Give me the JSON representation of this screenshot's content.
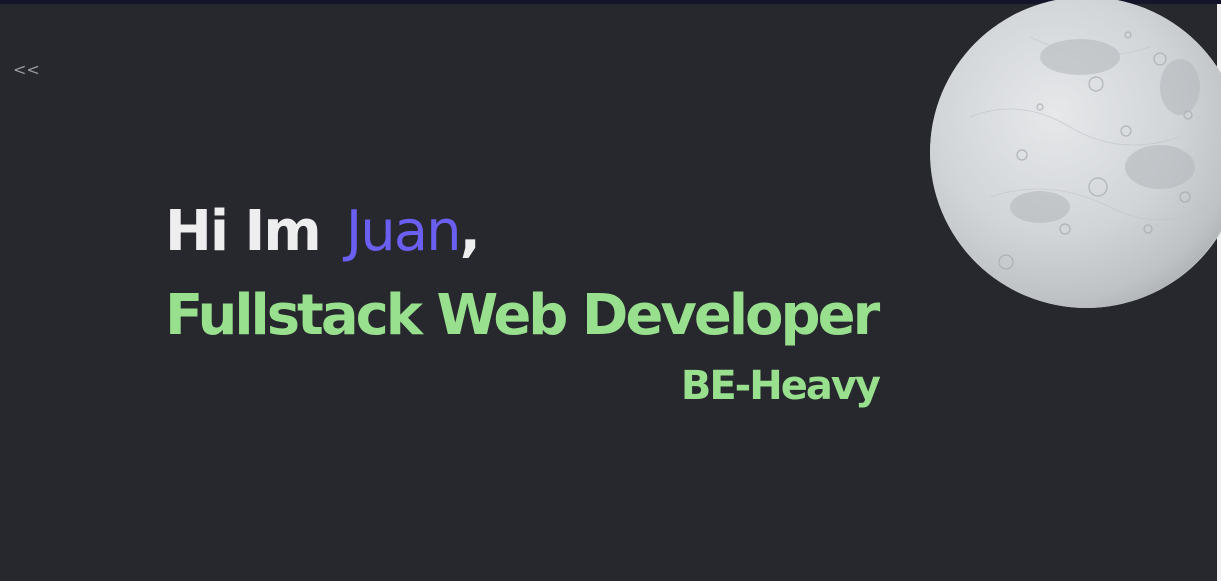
{
  "nav": {
    "back_label": "<<"
  },
  "hero": {
    "greeting": "Hi Im",
    "name": "Juan",
    "comma": ",",
    "role": "Fullstack Web Developer",
    "specialty": "BE-Heavy"
  },
  "colors": {
    "background": "#27272e",
    "name_accent": "#6a5ff0",
    "role_accent": "#98e08e",
    "greeting_text": "#eeeeef"
  },
  "icons": {
    "moon": "moon-image"
  }
}
